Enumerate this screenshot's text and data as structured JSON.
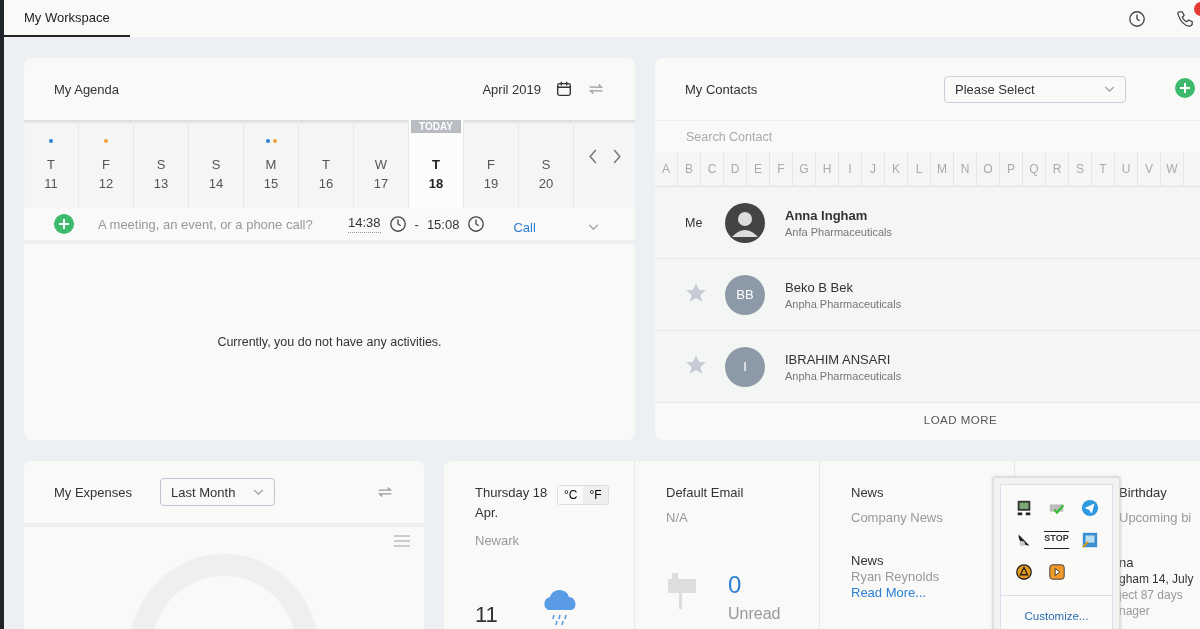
{
  "tabs": [
    {
      "label": "My Workspace",
      "selected": true
    }
  ],
  "agenda": {
    "title": "My Agenda",
    "month": "April 2019",
    "today_label": "TODAY",
    "days": [
      {
        "weekday": "T",
        "date": "11",
        "selected": false,
        "dots": [
          {
            "color": "#2b7fd4"
          }
        ]
      },
      {
        "weekday": "F",
        "date": "12",
        "selected": false,
        "dots": [
          {
            "color": "#f0a030"
          }
        ]
      },
      {
        "weekday": "S",
        "date": "13",
        "selected": false
      },
      {
        "weekday": "S",
        "date": "14",
        "selected": false
      },
      {
        "weekday": "M",
        "date": "15",
        "selected": false,
        "dots": [
          {
            "color": "#2b7fd4"
          },
          {
            "color": "#f0a030"
          }
        ]
      },
      {
        "weekday": "T",
        "date": "16",
        "selected": false
      },
      {
        "weekday": "W",
        "date": "17",
        "selected": false
      },
      {
        "weekday": "T",
        "date": "18",
        "selected": true
      },
      {
        "weekday": "F",
        "date": "19",
        "selected": false
      },
      {
        "weekday": "S",
        "date": "20",
        "selected": false
      }
    ],
    "new_entry": {
      "placeholder": "A meeting, an event, or a phone call?",
      "start": "14:38",
      "separator": "-",
      "end": "15:08",
      "type": "Call"
    },
    "empty_message": "Currently, you do not have any activities."
  },
  "contacts": {
    "title": "My Contacts",
    "filter": "Please Select",
    "search_placeholder": "Search Contact",
    "letters": [
      "A",
      "B",
      "C",
      "D",
      "E",
      "F",
      "G",
      "H",
      "I",
      "J",
      "K",
      "L",
      "M",
      "N",
      "O",
      "P",
      "Q",
      "R",
      "S",
      "T",
      "U",
      "V",
      "W"
    ],
    "people": [
      {
        "kind": "me",
        "label": "Me",
        "name": "Anna Ingham",
        "company": "Anfa Pharmaceuticals"
      },
      {
        "kind": "contact",
        "starred": false,
        "initials": "BB",
        "name": "Beko B Bek",
        "company": "Anpha Pharmaceuticals"
      },
      {
        "kind": "contact",
        "starred": false,
        "initials": "I",
        "name": "IBRAHIM ANSARI",
        "company": "Anpha Pharmaceuticals"
      }
    ],
    "load_more": "LOAD MORE"
  },
  "expenses": {
    "title": "My Expenses",
    "period": "Last Month"
  },
  "weather": {
    "date": "Thursday 18 Apr.",
    "units": [
      {
        "label": "°C",
        "selected": false
      },
      {
        "label": "°F",
        "selected": true
      }
    ],
    "city": "Newark",
    "temperature": "11"
  },
  "email": {
    "title": "Default Email",
    "address": "N/A",
    "count": "0",
    "count_label": "Unread"
  },
  "news": {
    "title": "News",
    "subtitle": "Company News",
    "items": [
      {
        "title": "News",
        "text": "Ryan Reynolds",
        "link": "Read More..."
      }
    ]
  },
  "birthday": {
    "title": "Birthday",
    "subtitle": "Upcoming bi",
    "entry": {
      "name_lines": [
        "na",
        "gham"
      ],
      "date": "14, July",
      "role_top": "ject",
      "days": "87 days",
      "role_bottom": "nager"
    }
  },
  "tray": {
    "icons": [
      {
        "kind": "monitor"
      },
      {
        "kind": "printer"
      },
      {
        "kind": "telegram"
      },
      {
        "kind": "satellite"
      },
      {
        "kind": "stop",
        "label": "STOP"
      },
      {
        "kind": "box"
      },
      {
        "kind": "triangle"
      },
      {
        "kind": "play"
      }
    ],
    "customize": "Customize..."
  }
}
